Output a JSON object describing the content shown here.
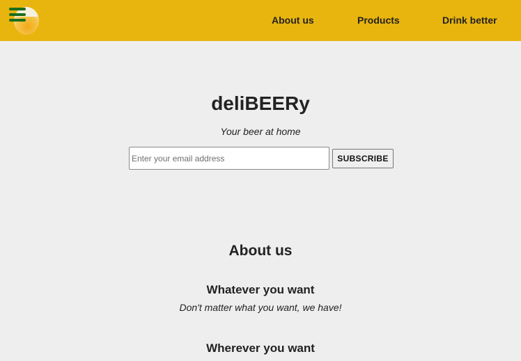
{
  "header": {
    "nav": [
      {
        "label": "About us"
      },
      {
        "label": "Products"
      },
      {
        "label": "Drink better"
      }
    ]
  },
  "hero": {
    "brand": "deliBEERy",
    "tagline": "Your beer at home",
    "email_placeholder": "Enter your email address",
    "subscribe_label": "SUBSCRIBE"
  },
  "about": {
    "title": "About us",
    "features": [
      {
        "title": "Whatever you want",
        "text": "Don't matter what you want, we have!"
      },
      {
        "title": "Wherever you want"
      }
    ]
  },
  "colors": {
    "header_bg": "#e8b40e",
    "page_bg": "#eeeeee",
    "menu_icon": "#1b6e1b"
  },
  "icons": {
    "menu": "hamburger-menu-icon",
    "logo": "beer-logo"
  }
}
